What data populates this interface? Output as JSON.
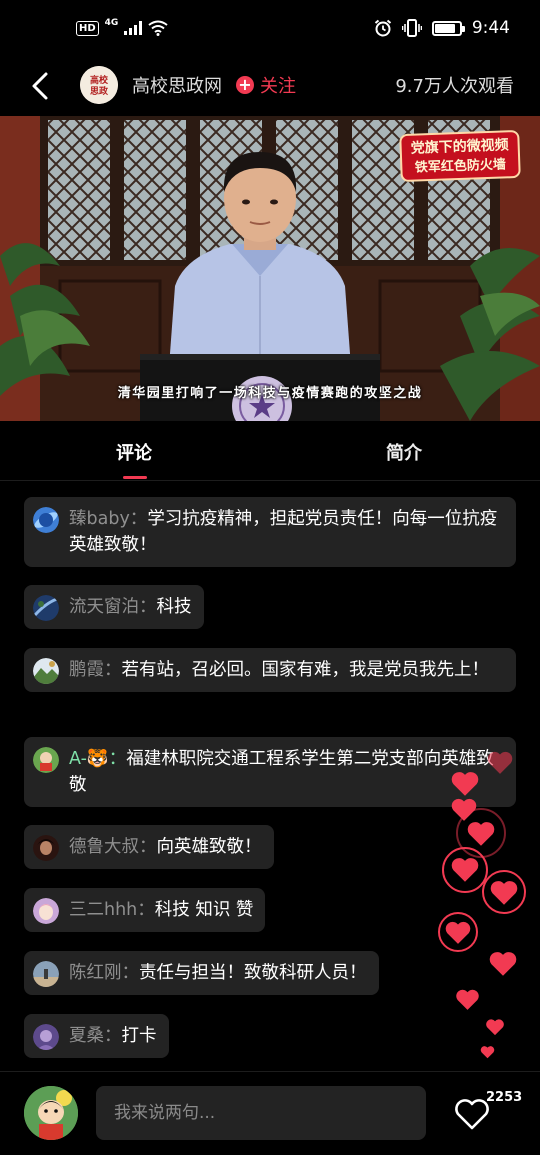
{
  "status_bar": {
    "hd": "HD",
    "network": "4G",
    "time": "9:44",
    "battery_level": 0.85
  },
  "top_bar": {
    "channel_name": "高校思政网",
    "channel_logo_text": "高校思政",
    "follow_label": "关注",
    "viewers": "9.7万人次观看"
  },
  "video": {
    "caption": "清华园里打响了一场科技与疫情赛跑的攻坚之战",
    "logo_line1": "党旗下的微视频",
    "logo_line2": "铁军红色防火墙"
  },
  "tabs": [
    {
      "label": "评论",
      "active": true
    },
    {
      "label": "简介",
      "active": false
    }
  ],
  "comments": [
    {
      "user": "臻baby：",
      "text": "学习抗疫精神，担起党员责任！向每一位抗疫英雄致敬！",
      "avatar": "planet-avatar"
    },
    {
      "user": "流天窗泊：",
      "text": "科技",
      "avatar": "earth-avatar"
    },
    {
      "user": "鹏霞：",
      "text": "若有站，召必回。国家有难，我是党员我先上！",
      "avatar": "landscape-avatar"
    },
    {
      "user": "A-🐯：",
      "text": "福建林职院交通工程系学生第二党支部向英雄致敬",
      "avatar": "cartoon-avatar"
    },
    {
      "user": "德鲁大叔：",
      "text": "向英雄致敬！",
      "avatar": "portrait-avatar"
    },
    {
      "user": "三二hhh：",
      "text": "科技 知识 赞",
      "avatar": "anime-avatar"
    },
    {
      "user": "陈红刚：",
      "text": "责任与担当！致敬科研人员！",
      "avatar": "photo-avatar"
    },
    {
      "user": "夏桑：",
      "text": "打卡",
      "avatar": "purple-avatar"
    }
  ],
  "bottom_bar": {
    "input_placeholder": "我来说两句...",
    "like_count": "2253"
  },
  "colors": {
    "accent": "#f23a52",
    "background": "#000000",
    "bubble": "#232323",
    "username": "#8f8f8f"
  }
}
